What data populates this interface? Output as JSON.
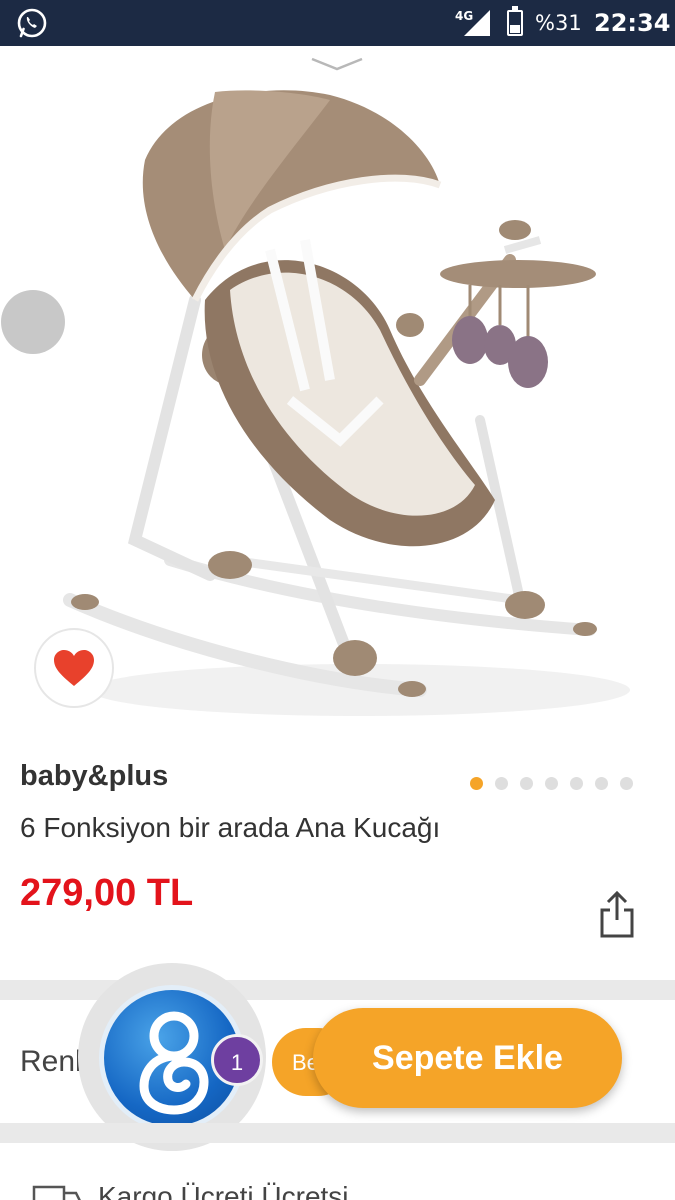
{
  "status_bar": {
    "network": "4G",
    "battery": "%31",
    "time": "22:34"
  },
  "product": {
    "brand": "baby&plus",
    "title": "6 Fonksiyon bir arada Ana Kucağı",
    "price": "279,00 TL",
    "image_count": 7,
    "active_image": 1
  },
  "options": {
    "color_label": "Renk",
    "color_value": "Be"
  },
  "cart": {
    "badge_count": "1",
    "add_label": "Sepete Ekle"
  },
  "shipping": {
    "text": "Kargo Ücreti    Ücretsi"
  },
  "colors": {
    "accent": "#f5a428",
    "price": "#e3131b",
    "badge": "#6e3fa0",
    "status_bar": "#1c2a44"
  }
}
